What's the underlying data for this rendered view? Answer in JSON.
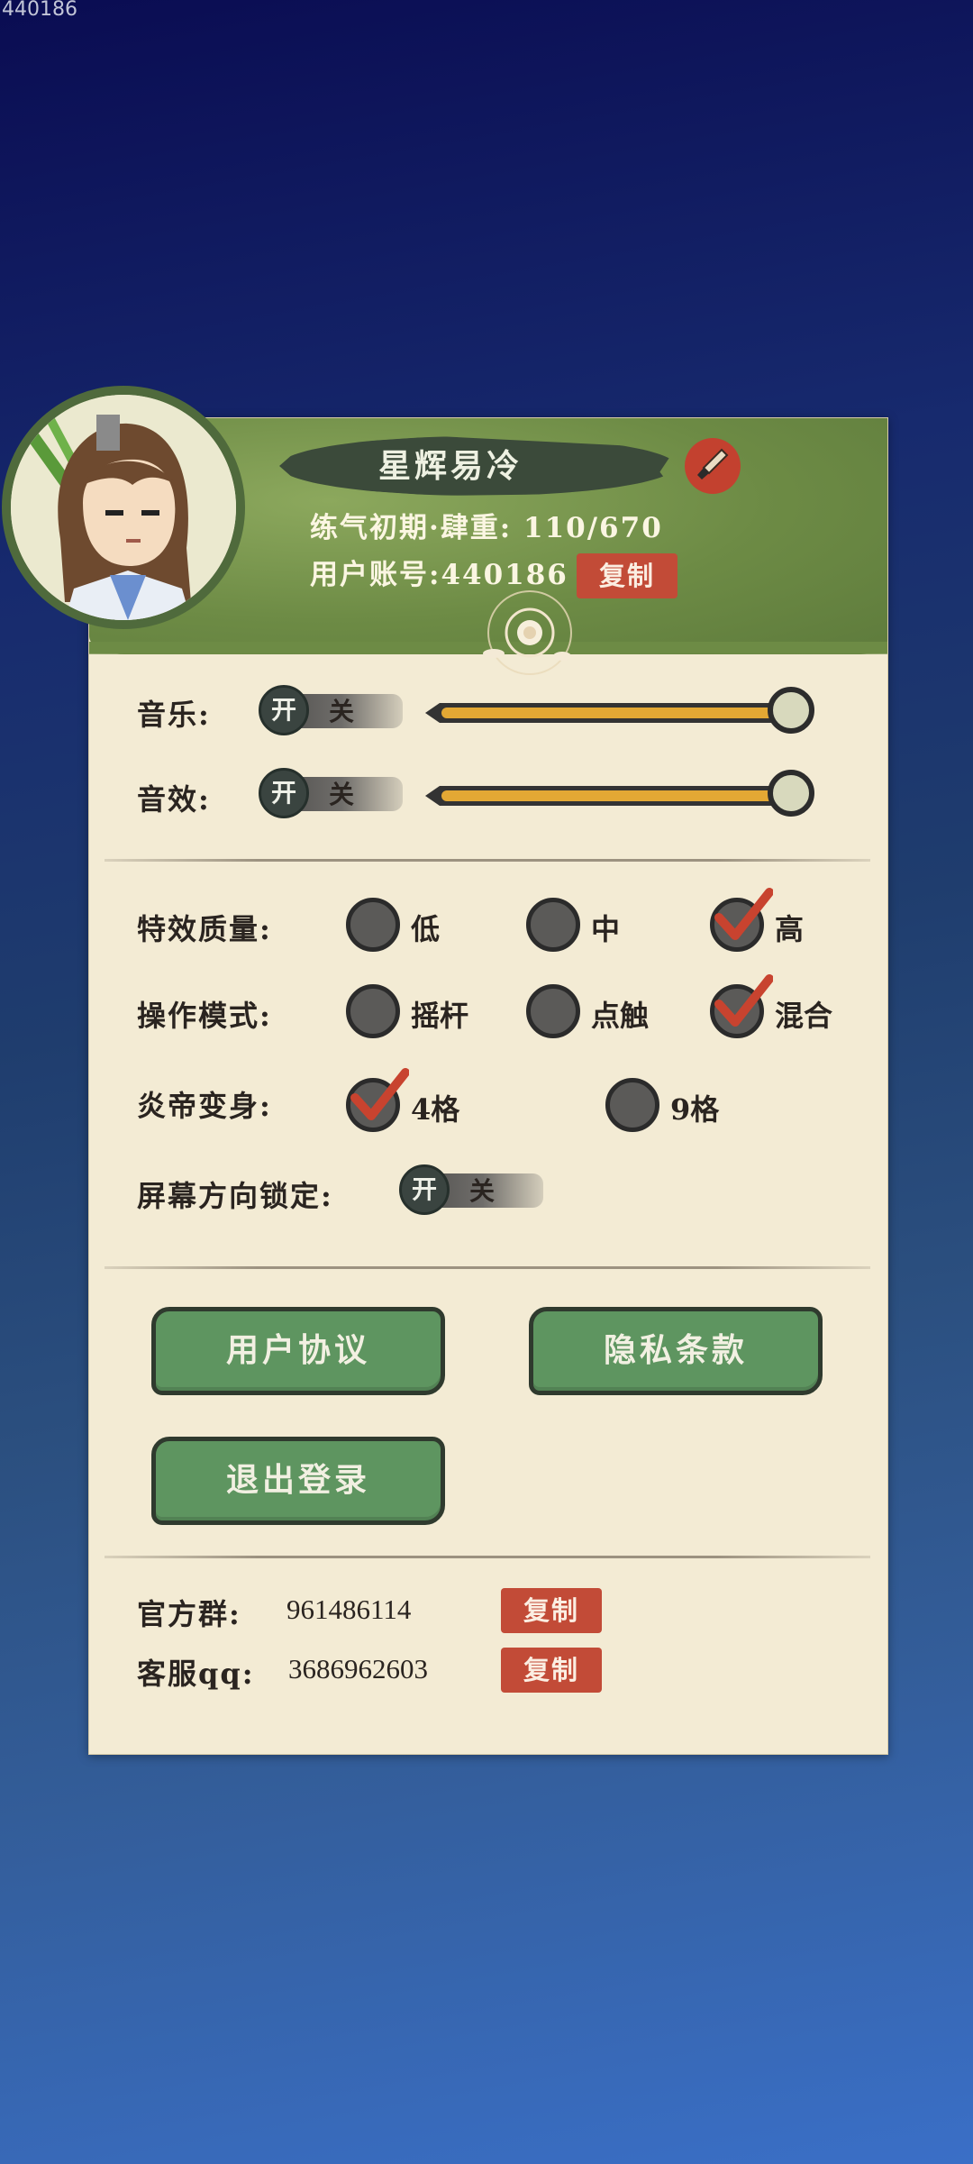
{
  "overlay": {
    "id_text": "440186"
  },
  "profile": {
    "name": "星辉易冷",
    "realm_line": "练气初期·肆重: 110/670",
    "account_line": "用户账号:440186",
    "copy_label": "复制"
  },
  "audio": {
    "music_label": "音乐:",
    "sfx_label": "音效:",
    "on": "开",
    "off": "关",
    "music_volume": 1.0,
    "sfx_volume": 1.0
  },
  "settings": {
    "effects": {
      "label": "特效质量:",
      "options": [
        "低",
        "中",
        "高"
      ],
      "selected": "高"
    },
    "control": {
      "label": "操作模式:",
      "options": [
        "摇杆",
        "点触",
        "混合"
      ],
      "selected": "混合"
    },
    "transform": {
      "label": "炎帝变身:",
      "options": [
        "4格",
        "9格"
      ],
      "selected": "4格"
    },
    "orientation": {
      "label": "屏幕方向锁定:",
      "on": "开",
      "off": "关"
    }
  },
  "buttons": {
    "user_agreement": "用户协议",
    "privacy": "隐私条款",
    "logout": "退出登录"
  },
  "info": {
    "group_label": "官方群:",
    "group_value": "961486114",
    "service_label": "客服qq:",
    "service_value": "3686962603",
    "copy_label": "复制"
  },
  "colors": {
    "panel": "#f3ebd4",
    "header_green": "#6d8b45",
    "accent_red": "#c24b37",
    "button_green": "#5e9560",
    "slider_fill": "#e3a834"
  }
}
